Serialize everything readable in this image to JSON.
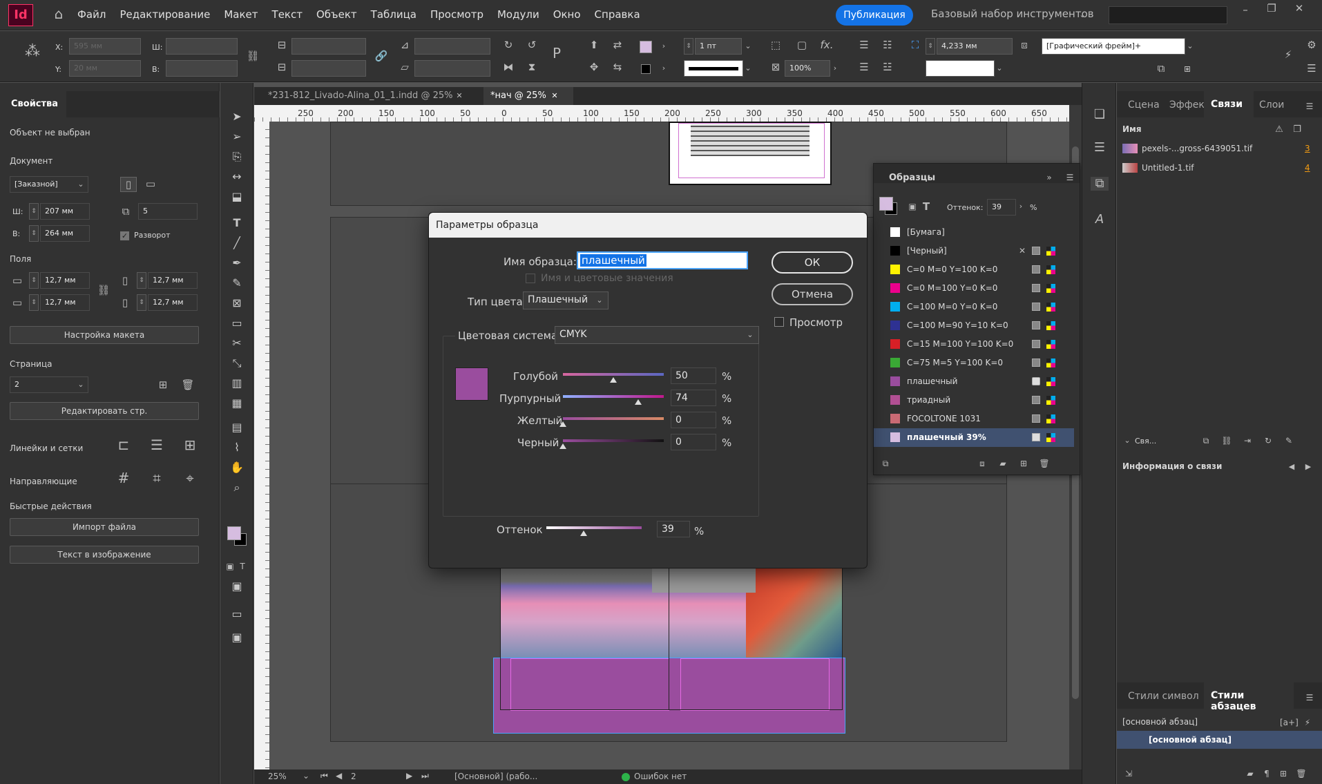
{
  "app": {
    "logo": "Id",
    "menu": [
      "Файл",
      "Редактирование",
      "Макет",
      "Текст",
      "Объект",
      "Таблица",
      "Просмотр",
      "Модули",
      "Окно",
      "Справка"
    ],
    "publish": "Публикация",
    "workspace": "Базовый набор инструментов"
  },
  "control_bar": {
    "x_label": "X:",
    "y_label": "Y:",
    "w_label": "Ш:",
    "h_label": "В:",
    "x_value": "595 мм",
    "y_value": "20 мм",
    "stroke_weight": "1 пт",
    "tint": "100%",
    "size_value": "4,233 мм",
    "frame_style": "[Графический фрейм]+"
  },
  "tabs": [
    {
      "label": "*231-812_Livado-Alina_01_1.indd @ 25%"
    },
    {
      "label": "*нач @ 25%"
    }
  ],
  "ruler": [
    "250",
    "200",
    "150",
    "100",
    "50",
    "0",
    "50",
    "100",
    "150",
    "200",
    "250",
    "300",
    "350",
    "400",
    "450",
    "500",
    "550",
    "600",
    "650"
  ],
  "properties": {
    "tab": "Свойства",
    "no_selection": "Объект не выбран",
    "document_label": "Документ",
    "preset": "[Заказной]",
    "w_label": "Ш:",
    "w_value": "207 мм",
    "h_label": "В:",
    "h_value": "264 мм",
    "pages_value": "5",
    "spread_label": "Разворот",
    "margins_label": "Поля",
    "margin_top": "12,7 мм",
    "margin_bottom": "12,7 мм",
    "margin_left": "12,7 мм",
    "margin_right": "12,7 мм",
    "layout_btn": "Настройка макета",
    "page_label": "Страница",
    "page_value": "2",
    "edit_page_btn": "Редактировать стр.",
    "rulers_grids": "Линейки и сетки",
    "guides": "Направляющие",
    "quick_actions": "Быстрые действия",
    "import_btn": "Импорт файла",
    "text_image_btn": "Текст в изображение"
  },
  "swatches_panel": {
    "title": "Образцы",
    "tint_label": "Оттенок:",
    "tint_value": "39",
    "pct": "%",
    "items": [
      {
        "name": "[Бумага]",
        "color": "#ffffff"
      },
      {
        "name": "[Черный]",
        "color": "#000000"
      },
      {
        "name": "C=0 M=0 Y=100 K=0",
        "color": "#fff200"
      },
      {
        "name": "C=0 M=100 Y=0 K=0",
        "color": "#ec008c"
      },
      {
        "name": "C=100 M=0 Y=0 K=0",
        "color": "#00aeef"
      },
      {
        "name": "C=100 M=90 Y=10 K=0",
        "color": "#2e3192"
      },
      {
        "name": "C=15 M=100 Y=100 K=0",
        "color": "#d71f26"
      },
      {
        "name": "C=75 M=5 Y=100 K=0",
        "color": "#3aa935"
      },
      {
        "name": "плашечный",
        "color": "#9a4d9e"
      },
      {
        "name": "триадный",
        "color": "#b14f93"
      },
      {
        "name": "FOCOLTONE 1031",
        "color": "#c96a74"
      },
      {
        "name": "плашечный 39%",
        "color": "#d6bde0"
      }
    ]
  },
  "right_panel": {
    "tabs": [
      "Сцена",
      "Эффек",
      "Связи",
      "Слои"
    ],
    "name_header": "Имя",
    "links": [
      {
        "name": "pexels-...gross-6439051.tif",
        "count": "3"
      },
      {
        "name": "Untitled-1.tif",
        "count": "4"
      }
    ],
    "sva": "Свя...",
    "link_info": "Информация о связи",
    "styles_tabs": [
      "Стили символ",
      "Стили абзацев"
    ],
    "base_para": "[основной абзац]",
    "base_para_selected": "[основной абзац]"
  },
  "dialog": {
    "title": "Параметры образца",
    "name_label": "Имя образца:",
    "name_value": "плашечный",
    "name_with_values": "Имя и цветовые значения",
    "color_type_label": "Тип цвета:",
    "color_type_value": "Плашечный",
    "color_mode_label": "Цветовая система:",
    "color_mode_value": "CMYK",
    "ok": "ОК",
    "cancel": "Отмена",
    "preview": "Просмотр",
    "channels": [
      {
        "label": "Голубой",
        "value": "50",
        "pct": "%"
      },
      {
        "label": "Пурпурный",
        "value": "74",
        "pct": "%"
      },
      {
        "label": "Желтый",
        "value": "0",
        "pct": "%"
      },
      {
        "label": "Черный",
        "value": "0",
        "pct": "%"
      }
    ],
    "tint_label": "Оттенок",
    "tint_value": "39",
    "tint_pct": "%",
    "swatch_color": "#9a4d9e"
  },
  "status": {
    "zoom": "25%",
    "page": "2",
    "style": "[Основной] (рабо...",
    "errors": "Ошибок нет"
  },
  "colors": {
    "accent": "#1473e6",
    "spot": "#9a4d9e",
    "selected_row": "#405170"
  }
}
